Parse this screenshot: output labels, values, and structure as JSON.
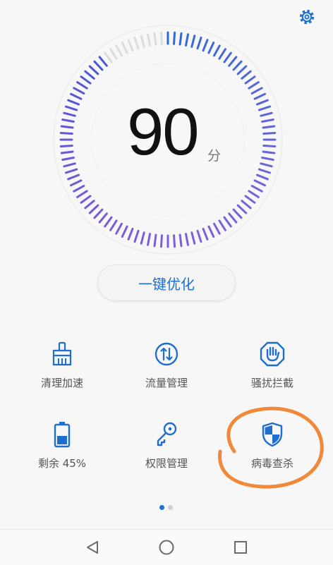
{
  "header": {
    "settings_icon": "gear-icon"
  },
  "score": {
    "value": "90",
    "unit": "分",
    "progress": 0.9
  },
  "optimize_button": {
    "label": "一键优化"
  },
  "tools": [
    {
      "label": "清理加速",
      "icon": "broom-icon"
    },
    {
      "label": "流量管理",
      "icon": "data-traffic-icon"
    },
    {
      "label": "骚扰拦截",
      "icon": "hand-block-icon"
    },
    {
      "label": "剩余 45%",
      "icon": "battery-icon"
    },
    {
      "label": "权限管理",
      "icon": "key-icon"
    },
    {
      "label": "病毒查杀",
      "icon": "shield-icon"
    }
  ],
  "pager": {
    "current": 1,
    "total": 2
  },
  "navbar": {
    "back_icon": "back-triangle-icon",
    "home_icon": "home-circle-icon",
    "recents_icon": "recents-square-icon"
  },
  "colors": {
    "accent": "#1f6fd1",
    "annotation": "#f0893a"
  }
}
